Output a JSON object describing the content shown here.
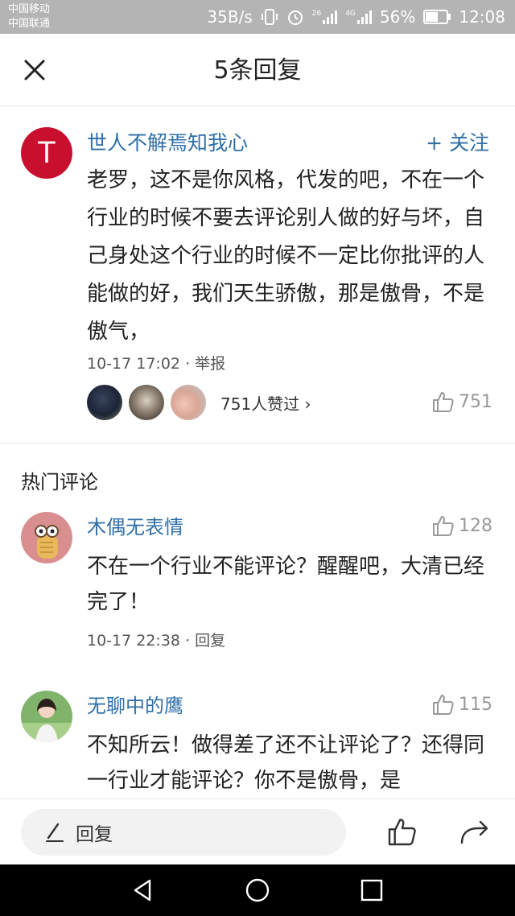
{
  "status": {
    "carrier1": "中国移动",
    "carrier2": "中国联通",
    "speed": "35B/s",
    "signal1": "26",
    "signal2": "4G",
    "battery": "56%",
    "time": "12:08"
  },
  "header": {
    "title": "5条回复"
  },
  "main_comment": {
    "author": "世人不解焉知我心",
    "avatar_letter": "T",
    "follow": "+ 关注",
    "text": "老罗，这不是你风格，代发的吧，不在一个行业的时候不要去评论别人做的好与坏，自己身处这个行业的时候不一定比你批评的人能做的好，我们天生骄傲，那是傲骨，不是傲气，",
    "time": "10-17 17:02",
    "action": "· 举报",
    "likers_text": "751人赞过 ›",
    "likes": "751"
  },
  "hot_section": {
    "title": "热门评论"
  },
  "comments": [
    {
      "author": "木偶无表情",
      "likes": "128",
      "text": "不在一个行业不能评论？醒醒吧，大清已经完了！",
      "time": "10-17 22:38",
      "action": "· 回复"
    },
    {
      "author": "无聊中的鹰",
      "likes": "115",
      "text": "不知所云！做得差了还不让评论了？还得同一行业才能评论？你不是傲骨，是"
    }
  ],
  "reply_bar": {
    "placeholder": "回复"
  },
  "colors": {
    "link_blue": "#2f6fa8",
    "avatar_red": "#c8102e",
    "status_bar": "#b4b4b4"
  }
}
